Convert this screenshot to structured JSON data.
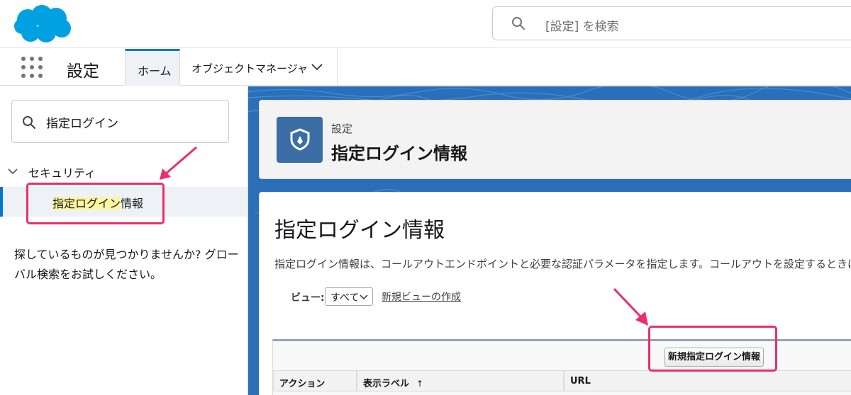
{
  "header": {
    "search_placeholder": "[設定] を検索"
  },
  "nav": {
    "app_name": "設定",
    "tabs": [
      {
        "label": "ホーム"
      },
      {
        "label": "オブジェクトマネージャ"
      }
    ]
  },
  "sidebar": {
    "quick_find_value": "指定ログイン",
    "section_label": "セキュリティ",
    "item": {
      "label_highlight": "指定ログイン",
      "label_rest": "情報"
    },
    "hint_text": "探しているものが見つかりませんか? グローバル検索をお試しください。"
  },
  "page_header": {
    "kicker": "設定",
    "title": "指定ログイン情報"
  },
  "content": {
    "heading": "指定ログイン情報",
    "description": "指定ログイン情報は、コールアウトエンドポイントと必要な認証パラメータを指定します。コールアウトを設定するときは、指定ロ",
    "view_label": "ビュー:",
    "view_selected": "すべて",
    "create_view_link": "新規ビューの作成",
    "new_button": "新規指定ログイン情報",
    "columns": [
      "アクション",
      "表示ラベル",
      "URL"
    ],
    "sort_indicator": "↑"
  },
  "colors": {
    "brand_blue": "#0176d3",
    "logo_blue": "#00a1e0",
    "callout_pink": "#ea2f6b",
    "banner_blue": "#1b5da8"
  }
}
